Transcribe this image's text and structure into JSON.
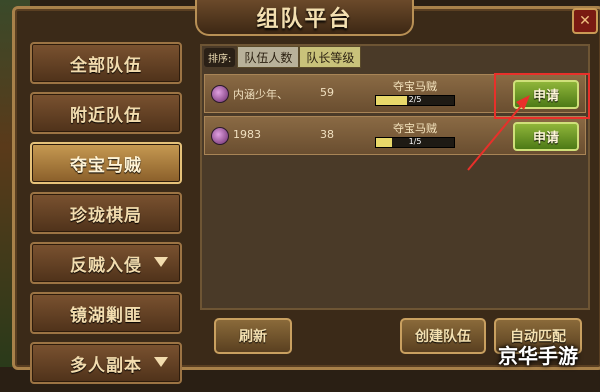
{
  "window": {
    "title": "组队平台",
    "close_icon": "close-icon"
  },
  "sidebar": {
    "items": [
      {
        "label": "全部队伍",
        "active": false,
        "dropdown": false
      },
      {
        "label": "附近队伍",
        "active": false,
        "dropdown": false
      },
      {
        "label": "夺宝马贼",
        "active": true,
        "dropdown": false
      },
      {
        "label": "珍珑棋局",
        "active": false,
        "dropdown": false
      },
      {
        "label": "反贼入侵",
        "active": false,
        "dropdown": true
      },
      {
        "label": "镜湖剿匪",
        "active": false,
        "dropdown": false
      },
      {
        "label": "多人副本",
        "active": false,
        "dropdown": true
      }
    ]
  },
  "sort": {
    "label": "排序:",
    "options": [
      "队伍人数",
      "队长等级"
    ]
  },
  "teams": [
    {
      "name": "内涵少年、",
      "level": "59",
      "activity": "夺宝马贼",
      "members": "2/5",
      "fill": 0.4,
      "apply_label": "申请"
    },
    {
      "name": "1983",
      "level": "38",
      "activity": "夺宝马贼",
      "members": "1/5",
      "fill": 0.2,
      "apply_label": "申请"
    }
  ],
  "footer": {
    "refresh_label": "刷新",
    "create_label": "创建队伍",
    "auto_label": "自动匹配"
  },
  "watermark": "京华手游",
  "colors": {
    "accent": "#c9a060",
    "apply": "#6a9a26",
    "highlight": "#e8302a"
  }
}
